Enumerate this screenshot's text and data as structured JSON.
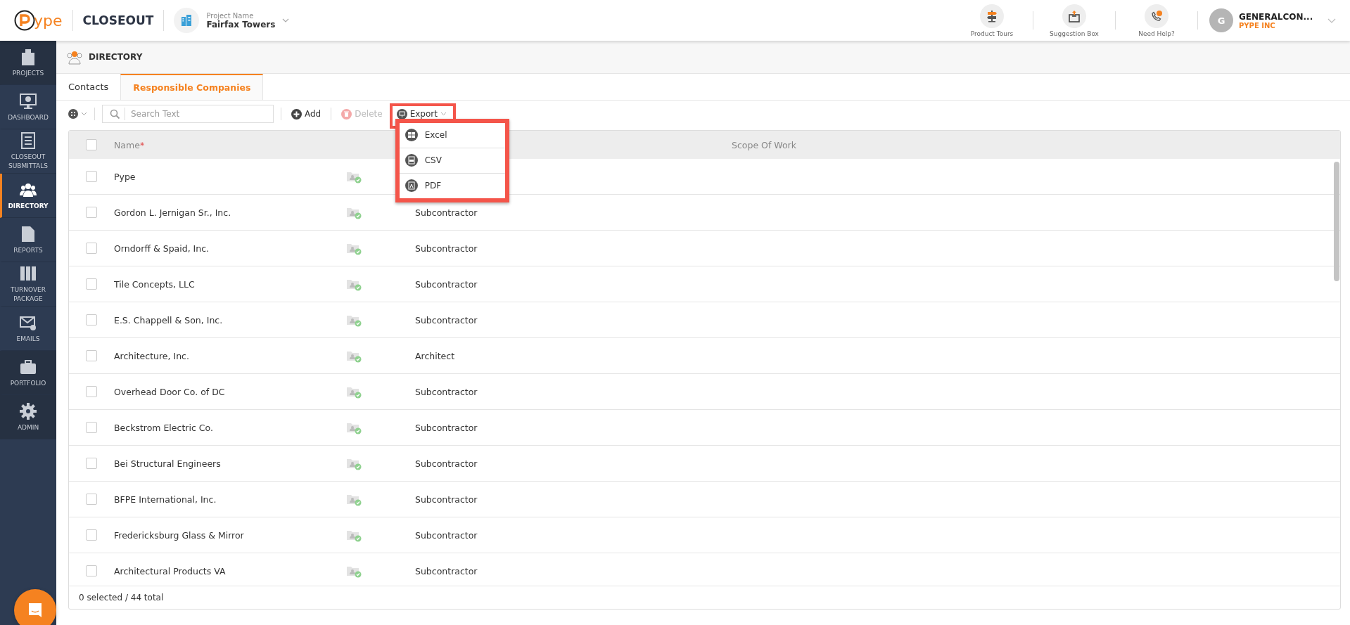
{
  "header": {
    "logo_text": "ype",
    "app_name": "CLOSEOUT",
    "project_label": "Project Name",
    "project_name": "Fairfax Towers",
    "tools": [
      {
        "label": "Product Tours",
        "kind": "tours"
      },
      {
        "label": "Suggestion Box",
        "kind": "suggest"
      },
      {
        "label": "Need Help?",
        "kind": "help"
      }
    ],
    "user": {
      "initial": "G",
      "name": "GENERALCON...",
      "company": "PYPE INC"
    }
  },
  "sidebar": {
    "items": [
      {
        "label": "PROJECTS",
        "kind": "projects",
        "selected": false
      },
      {
        "label": "DASHBOARD",
        "kind": "dashboard",
        "selected": false
      },
      {
        "label": "CLOSEOUT SUBMITTALS",
        "kind": "submittals",
        "selected": false
      },
      {
        "label": "DIRECTORY",
        "kind": "directory",
        "selected": true
      },
      {
        "label": "REPORTS",
        "kind": "reports",
        "selected": false
      },
      {
        "label": "TURNOVER PACKAGE",
        "kind": "turnover",
        "selected": false
      },
      {
        "label": "EMAILS",
        "kind": "emails",
        "selected": false
      },
      {
        "label": "PORTFOLIO",
        "kind": "portfolio",
        "selected": false
      },
      {
        "label": "ADMIN",
        "kind": "admin",
        "selected": false
      }
    ]
  },
  "page_title": "DIRECTORY",
  "tabs": [
    {
      "label": "Contacts",
      "selected": false
    },
    {
      "label": "Responsible Companies",
      "selected": true
    }
  ],
  "toolbar": {
    "search": {
      "placeholder": "Search Text"
    },
    "add": {
      "label": "Add"
    },
    "delete": {
      "label": "Delete",
      "disabled": true
    },
    "export": {
      "label": "Export"
    }
  },
  "export_menu": [
    {
      "label": "Excel",
      "kind": "excel"
    },
    {
      "label": "CSV",
      "kind": "csv"
    },
    {
      "label": "PDF",
      "kind": "pdf"
    }
  ],
  "table": {
    "all_checked": false,
    "columns": [
      {
        "label": "Name",
        "marker": "*"
      },
      {
        "label": "Scope Of Work"
      }
    ],
    "rows": [
      {
        "name": "Pype",
        "checked": false
      },
      {
        "name": "Gordon L. Jernigan Sr., Inc.",
        "scope": "Subcontractor",
        "checked": false
      },
      {
        "name": "Orndorff & Spaid, Inc.",
        "scope": "Subcontractor",
        "checked": false
      },
      {
        "name": "Tile Concepts, LLC",
        "scope": "Subcontractor",
        "checked": false
      },
      {
        "name": "E.S. Chappell & Son, Inc.",
        "scope": "Subcontractor",
        "checked": false
      },
      {
        "name": "Architecture, Inc.",
        "scope": "Architect",
        "checked": false
      },
      {
        "name": "Overhead Door Co. of DC",
        "scope": "Subcontractor",
        "checked": false
      },
      {
        "name": "Beckstrom Electric Co.",
        "scope": "Subcontractor",
        "checked": false
      },
      {
        "name": "Bei Structural Engineers",
        "scope": "Subcontractor",
        "checked": false
      },
      {
        "name": "BFPE International, Inc.",
        "scope": "Subcontractor",
        "checked": false
      },
      {
        "name": "Fredericksburg Glass & Mirror",
        "scope": "Subcontractor",
        "checked": false
      },
      {
        "name": "Architectural Products VA",
        "scope": "Subcontractor",
        "checked": false
      }
    ],
    "footer": "0 selected / 44 total"
  }
}
